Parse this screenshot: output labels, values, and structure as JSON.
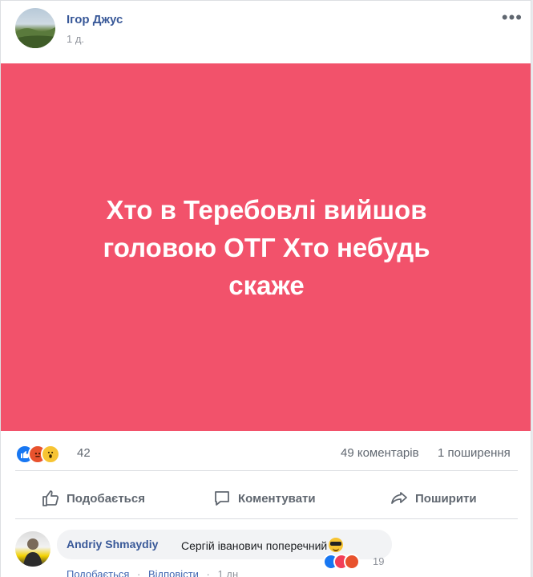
{
  "post": {
    "author": "Ігор Джус",
    "time": "1 д.",
    "more": "•••",
    "text": "Хто в Теребовлі вийшов головою ОТГ Хто небудь скаже",
    "background_color": "#f2526b"
  },
  "stats": {
    "reactions_count": "42",
    "comments": "49 коментарів",
    "shares": "1 поширення"
  },
  "actions": {
    "like": "Подобається",
    "comment": "Коментувати",
    "share": "Поширити"
  },
  "comment": {
    "author": "Andriy Shmaydiy",
    "text": "Сергій іванович поперечний",
    "reactions_count": "19",
    "meta_like": "Подобається",
    "meta_reply": "Відповісти",
    "meta_time": "1 дн",
    "separator": "·"
  }
}
